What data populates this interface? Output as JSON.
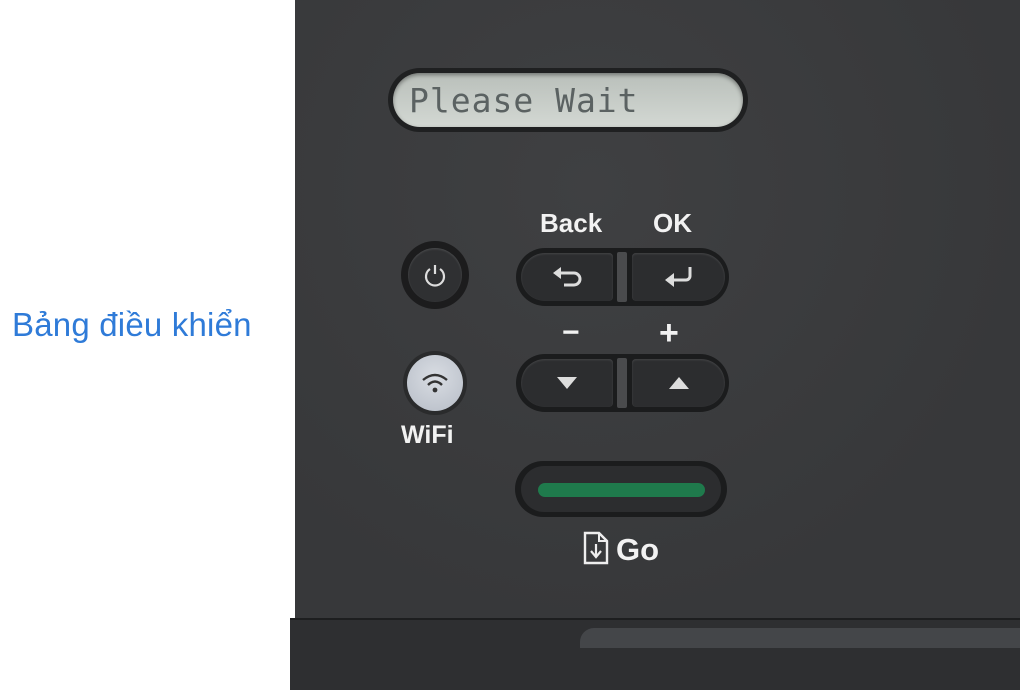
{
  "caption": "Bảng điều khiển",
  "lcd": {
    "text": "Please Wait"
  },
  "labels": {
    "back": "Back",
    "ok": "OK",
    "minus": "−",
    "plus": "+",
    "wifi": "WiFi",
    "go": "Go"
  },
  "icons": {
    "power": "power-icon",
    "wifi": "wifi-icon",
    "back": "back-arrow-icon",
    "ok": "enter-icon",
    "down": "triangle-down-icon",
    "up": "triangle-up-icon",
    "go": "document-download-icon"
  },
  "colors": {
    "caption": "#2f7bd8",
    "go_bar": "#1f7a4c",
    "panel": "#3a3b3d"
  }
}
